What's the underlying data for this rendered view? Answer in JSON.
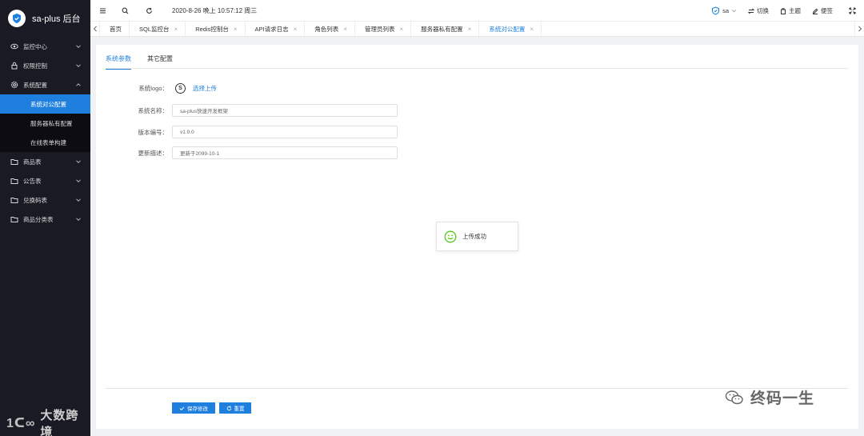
{
  "brand": {
    "title": "sa-plus 后台"
  },
  "sidebar": {
    "items": [
      {
        "label": "监控中心",
        "icon": "eye-icon"
      },
      {
        "label": "权限控制",
        "icon": "lock-icon"
      },
      {
        "label": "系统配置",
        "icon": "gear-icon",
        "expanded": true,
        "children": [
          {
            "label": "系统对公配置",
            "active": true
          },
          {
            "label": "服务器私有配置"
          },
          {
            "label": "在线表单构建"
          }
        ]
      },
      {
        "label": "商品表",
        "icon": "folder-icon"
      },
      {
        "label": "公告表",
        "icon": "folder-icon"
      },
      {
        "label": "兑换码表",
        "icon": "folder-icon"
      },
      {
        "label": "商品分类表",
        "icon": "folder-icon"
      }
    ]
  },
  "header": {
    "datetime": "2020-8-26 晚上 10:57:12 周三",
    "user": "sa",
    "switch_label": "切换",
    "theme_label": "主题",
    "notes_label": "便签"
  },
  "tabs": [
    {
      "label": "首页",
      "closable": false
    },
    {
      "label": "SQL监控台",
      "closable": true
    },
    {
      "label": "Redis控制台",
      "closable": true
    },
    {
      "label": "API请求日志",
      "closable": true
    },
    {
      "label": "角色列表",
      "closable": true
    },
    {
      "label": "管理员列表",
      "closable": true
    },
    {
      "label": "服务器私有配置",
      "closable": true
    },
    {
      "label": "系统对公配置",
      "closable": true,
      "active": true
    }
  ],
  "subtabs": [
    {
      "label": "系统参数",
      "active": true
    },
    {
      "label": "其它配置"
    }
  ],
  "form": {
    "logo_label": "系统logo：",
    "logo_glyph": "S",
    "upload_label": "选择上传",
    "name_label": "系统名称：",
    "name_value": "sa-plus快速开发框架",
    "version_label": "版本编号：",
    "version_value": "v1.0.0",
    "desc_label": "更新描述：",
    "desc_value": "更新于2099-10-1"
  },
  "toast": {
    "message": "上传成功"
  },
  "buttons": {
    "save_label": "保存修改",
    "reset_label": "重置"
  },
  "watermarks": {
    "left": "大数跨境",
    "right": "终码一生"
  },
  "colors": {
    "accent": "#1e7fde",
    "sidebar_bg": "#191a23",
    "success": "#52c41a"
  }
}
